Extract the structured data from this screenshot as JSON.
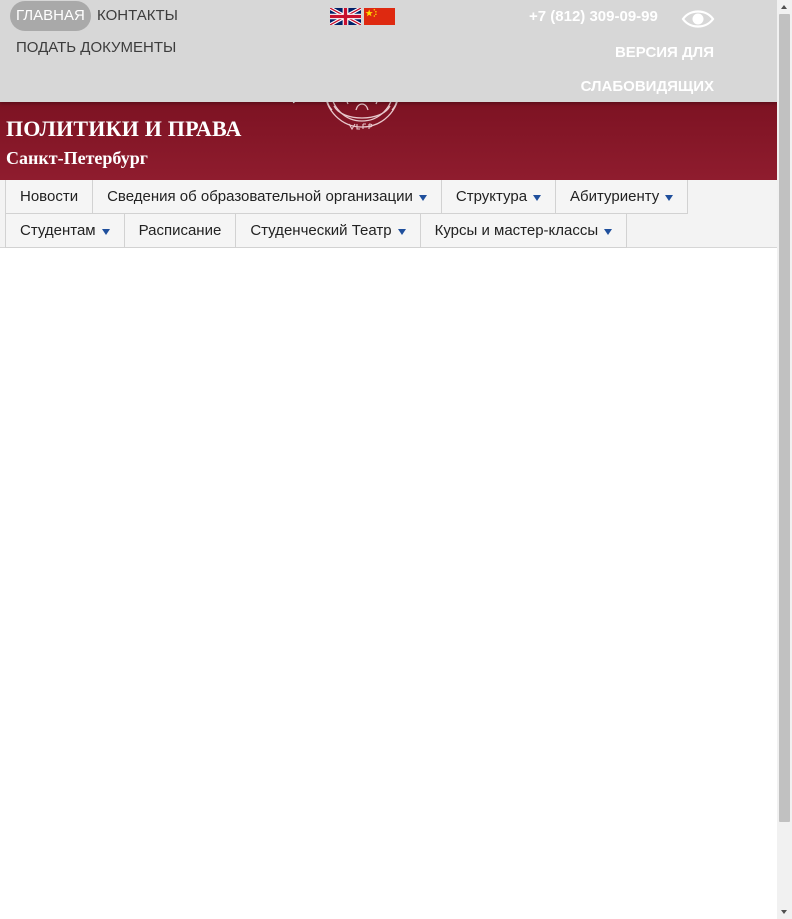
{
  "top_nav": {
    "home": "ГЛАВНАЯ",
    "contacts": "КОНТАКТЫ",
    "submit_documents": "ПОДАТЬ ДОКУМЕНТЫ"
  },
  "languages": [
    {
      "icon": "uk-flag-icon"
    },
    {
      "icon": "china-flag-icon"
    }
  ],
  "contact": {
    "phone": "+7 (812) 309-09-99"
  },
  "accessibility": {
    "icon": "eye-icon",
    "label": "ВЕРСИЯ ДЛЯ СЛАБОВИДЯЩИХ"
  },
  "header": {
    "title": "ПОЛИТИКИ И ПРАВА",
    "city": "Санкт-Петербург"
  },
  "menu": {
    "row1": [
      {
        "label": "Новости",
        "has_submenu": false
      },
      {
        "label": "Сведения об образовательной организации",
        "has_submenu": true
      },
      {
        "label": "Структура",
        "has_submenu": true
      },
      {
        "label": "Абитуриенту",
        "has_submenu": true
      }
    ],
    "row2": [
      {
        "label": "Студентам",
        "has_submenu": true
      },
      {
        "label": "Расписание",
        "has_submenu": false
      },
      {
        "label": "Студенческий Театр",
        "has_submenu": true
      },
      {
        "label": "Курсы и мастер-классы",
        "has_submenu": true
      }
    ]
  },
  "colors": {
    "banner": "#7c1222",
    "top_bar": "#d7d7d7",
    "active_pill": "#a9a9a9",
    "menu_caret": "#1f4f9c"
  }
}
